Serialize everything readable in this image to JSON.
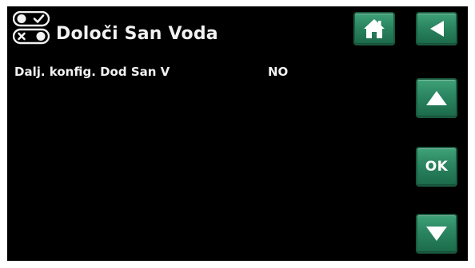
{
  "header": {
    "title": "Določi San Voda",
    "icon": "settings-toggle-icon"
  },
  "settings": [
    {
      "label": "Dalj. konfig. Dod San V",
      "value": "NO"
    }
  ],
  "buttons": {
    "home_icon": "home-icon",
    "back_icon": "back-arrow-icon",
    "up_icon": "up-arrow-icon",
    "ok_label": "OK",
    "down_icon": "down-arrow-icon"
  },
  "colors": {
    "background": "#000000",
    "text": "#f2f2f2",
    "button": "#2a8560"
  }
}
